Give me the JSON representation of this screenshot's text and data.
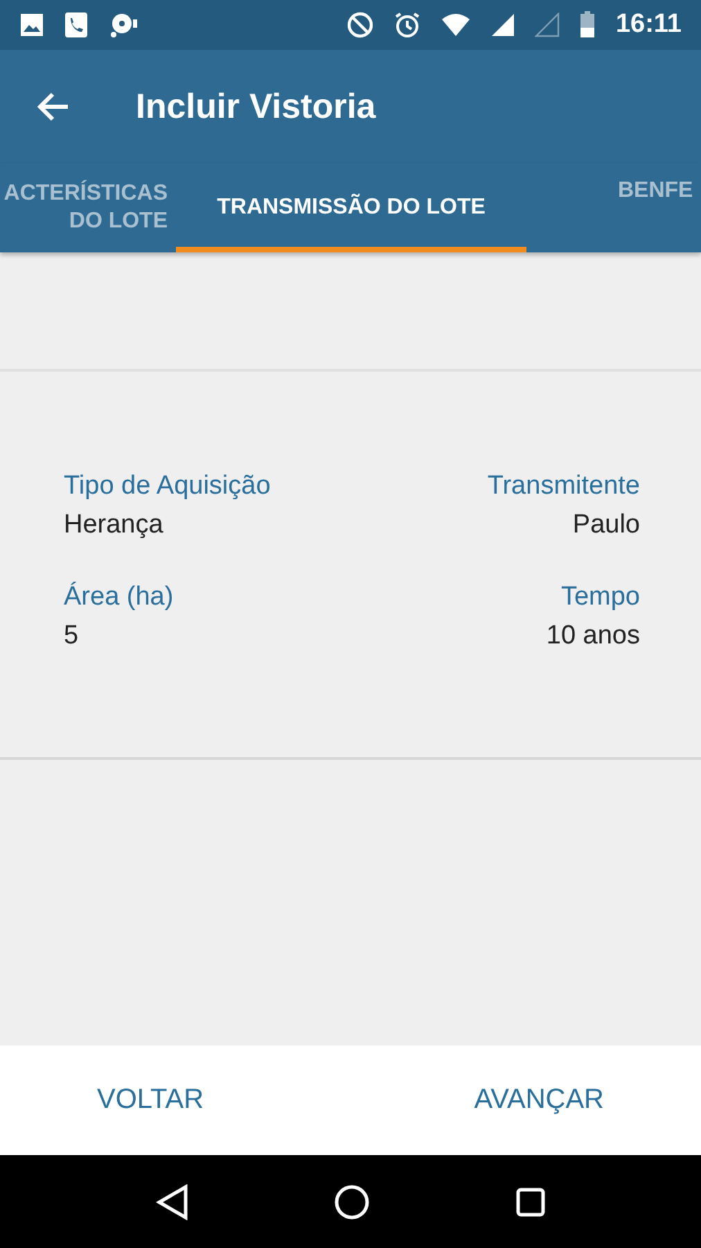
{
  "status_bar": {
    "time": "16:11"
  },
  "app_bar": {
    "title": "Incluir Vistoria"
  },
  "tabs": [
    {
      "lines": [
        "ACTERÍSTICAS",
        "DO LOTE"
      ],
      "selected": false
    },
    {
      "lines": [
        "TRANSMISSÃO DO LOTE"
      ],
      "selected": true
    },
    {
      "lines": [
        "BENFE"
      ],
      "selected": false
    }
  ],
  "fields": [
    {
      "label": "Tipo de Aquisição",
      "value": "Herança"
    },
    {
      "label": "Transmitente",
      "value": "Paulo"
    },
    {
      "label": "Área (ha)",
      "value": "5"
    },
    {
      "label": "Tempo",
      "value": "10 anos"
    }
  ],
  "buttons": [
    "VOLTAR",
    "AVANÇAR"
  ]
}
